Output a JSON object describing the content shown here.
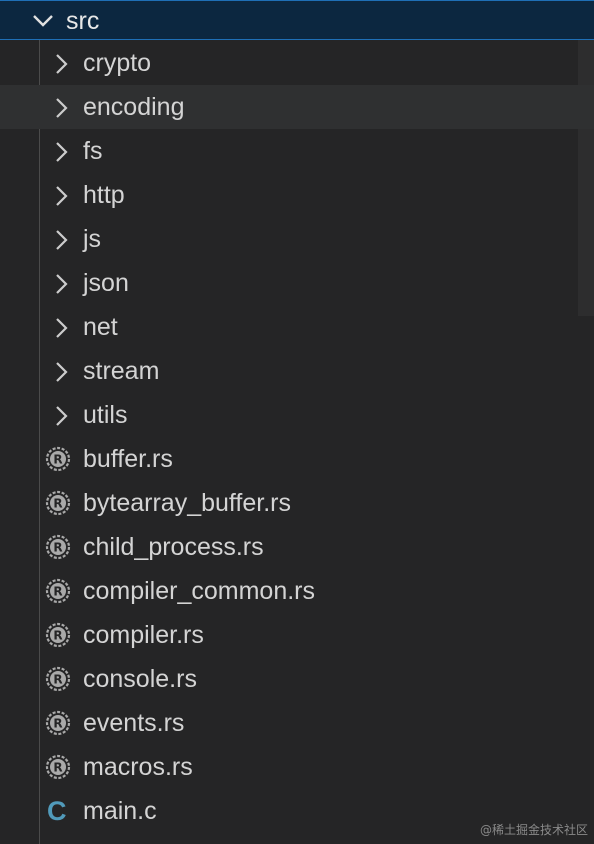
{
  "explorer": {
    "root_folder": {
      "label": "src",
      "expanded": true,
      "icon": "chevron-down-icon"
    },
    "folders": [
      {
        "label": "crypto",
        "icon": "chevron-right-icon"
      },
      {
        "label": "encoding",
        "icon": "chevron-right-icon",
        "hovered": true
      },
      {
        "label": "fs",
        "icon": "chevron-right-icon"
      },
      {
        "label": "http",
        "icon": "chevron-right-icon"
      },
      {
        "label": "js",
        "icon": "chevron-right-icon"
      },
      {
        "label": "json",
        "icon": "chevron-right-icon"
      },
      {
        "label": "net",
        "icon": "chevron-right-icon"
      },
      {
        "label": "stream",
        "icon": "chevron-right-icon"
      },
      {
        "label": "utils",
        "icon": "chevron-right-icon"
      }
    ],
    "files": [
      {
        "label": "buffer.rs",
        "icon": "rust-file-icon"
      },
      {
        "label": "bytearray_buffer.rs",
        "icon": "rust-file-icon"
      },
      {
        "label": "child_process.rs",
        "icon": "rust-file-icon"
      },
      {
        "label": "compiler_common.rs",
        "icon": "rust-file-icon"
      },
      {
        "label": "compiler.rs",
        "icon": "rust-file-icon"
      },
      {
        "label": "console.rs",
        "icon": "rust-file-icon"
      },
      {
        "label": "events.rs",
        "icon": "rust-file-icon"
      },
      {
        "label": "macros.rs",
        "icon": "rust-file-icon"
      },
      {
        "label": "main.c",
        "icon": "c-file-icon",
        "glyph": "C"
      }
    ]
  },
  "watermark": "@稀土掘金技术社区",
  "colors": {
    "background": "#252526",
    "selected_row": "#0c2740",
    "selected_border": "#1f6fb6",
    "hover_row": "#2f3031",
    "text": "#d4d4d4",
    "c_icon": "#519aba"
  }
}
